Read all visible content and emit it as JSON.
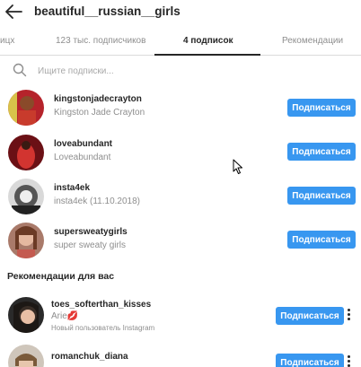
{
  "header": {
    "title": "beautiful__russian__girls"
  },
  "tabs": [
    {
      "label": "ицх"
    },
    {
      "label": "123 тыс. подписчиков"
    },
    {
      "label": "4 подписок"
    },
    {
      "label": "Рекомендации"
    }
  ],
  "search": {
    "placeholder": "Ищите подписки..."
  },
  "following": [
    {
      "username": "kingstonjadecrayton",
      "name": "Kingston Jade Crayton",
      "button": "Подписаться"
    },
    {
      "username": "loveabundant",
      "name": "Loveabundant",
      "button": "Подписаться"
    },
    {
      "username": "insta4ek",
      "name": "insta4ek (11.10.2018)",
      "button": "Подписаться"
    },
    {
      "username": "supersweatygirls",
      "name": "super sweaty girls",
      "button": "Подписаться"
    }
  ],
  "recommendations": {
    "title": "Рекомендации для вас",
    "items": [
      {
        "username": "toes_softerthan_kisses",
        "name": "Arie💋",
        "subtitle": "Новый пользователь Instagram",
        "button": "Подписаться"
      },
      {
        "username": "romanchuk_diana",
        "name": "",
        "subtitle": "",
        "button": "Подписаться"
      }
    ]
  },
  "colors": {
    "accent": "#3897f0",
    "text": "#262626",
    "muted": "#8e8e8e"
  }
}
